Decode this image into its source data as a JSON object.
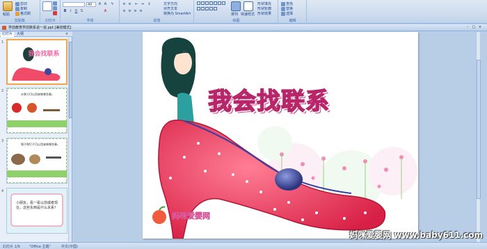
{
  "ribbon": {
    "groups": [
      {
        "label": "剪贴板"
      },
      {
        "label": "幻灯片"
      },
      {
        "label": "字体"
      },
      {
        "label": "段落"
      },
      {
        "label": "绘图"
      },
      {
        "label": "编辑"
      }
    ],
    "buttons": {
      "paste": "粘贴",
      "cut": "剪切",
      "copy": "复制",
      "format_painter": "格式刷",
      "new_slide": "新建",
      "layout": "版式",
      "reset": "重设",
      "delete": "删除",
      "text_direction": "文字方向",
      "align_text": "对齐文本",
      "smartart": "转换为 SmartArt",
      "arrange": "排列",
      "quick_styles": "快速样式",
      "shape_fill": "形状填充",
      "shape_outline": "形状轮廓",
      "shape_effects": "形状效果",
      "find": "查找",
      "replace": "替换",
      "select": "选择"
    },
    "font_size": "40"
  },
  "window": {
    "title": "学前教育学前数系说一说.ppt [兼容模式]"
  },
  "left_panel": {
    "tabs": [
      "幻灯片",
      "大纲"
    ],
    "slides": [
      {
        "num": "1",
        "text": "我会找联系"
      },
      {
        "num": "2",
        "text": "水果刀可以用来做哪些事。"
      },
      {
        "num": "3",
        "text": "锤子和钉子可以用来做哪些事。"
      },
      {
        "num": "4",
        "text": "小朋友，看一看以前或者现在，这些东西是什么关系？"
      }
    ]
  },
  "slide": {
    "title": "我会找联系",
    "logo": "妈咪爱婴网"
  },
  "statusbar": {
    "slide_info": "幻灯片 1/9",
    "theme": "\"Office 主题\"",
    "language": "中文(中国)"
  },
  "watermark": "妈咪爱婴网 www.baby611.com",
  "colors": {
    "ribbon_bg": "#cfdcee",
    "title_pink": "#f46aa4",
    "selection": "#f3a54a"
  }
}
